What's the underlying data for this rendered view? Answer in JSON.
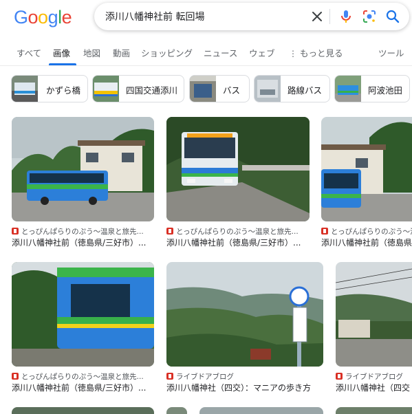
{
  "logo": {
    "text": "Google"
  },
  "search": {
    "query": "添川八幡神社前 転回場"
  },
  "tabs": [
    {
      "label": "すべて"
    },
    {
      "label": "画像"
    },
    {
      "label": "地図"
    },
    {
      "label": "動画"
    },
    {
      "label": "ショッピング"
    },
    {
      "label": "ニュース"
    },
    {
      "label": "ウェブ"
    },
    {
      "label": "もっと見る"
    },
    {
      "label": "ツール"
    }
  ],
  "chips": [
    {
      "label": "かずら橋"
    },
    {
      "label": "四国交通添川"
    },
    {
      "label": "バス"
    },
    {
      "label": "路線バス"
    },
    {
      "label": "阿波池田"
    }
  ],
  "results": [
    {
      "source": "とっぴんぱらりのぷう～温泉と旅先...",
      "title": "添川八幡神社前（徳島県/三好市）..."
    },
    {
      "source": "とっぴんぱらりのぷう～温泉と旅先...",
      "title": "添川八幡神社前（徳島県/三好市）..."
    },
    {
      "source": "とっぴんぱらりのぷう～温泉と旅先...",
      "title": "添川八幡神社前（徳島県"
    },
    {
      "source": "とっぴんぱらりのぷう～温泉と旅先...",
      "title": "添川八幡神社前（徳島県/三好市）..."
    },
    {
      "source": "ライブドアブログ",
      "title": "添川八幡神社（四交）：マニアの歩き方"
    },
    {
      "source": "ライブドアブログ",
      "title": "添川八幡神社（四交"
    }
  ],
  "colors": {
    "blue": "#4285F4",
    "red": "#EA4335",
    "yellow": "#FBBC05",
    "green": "#34A853",
    "accent": "#1a73e8"
  }
}
